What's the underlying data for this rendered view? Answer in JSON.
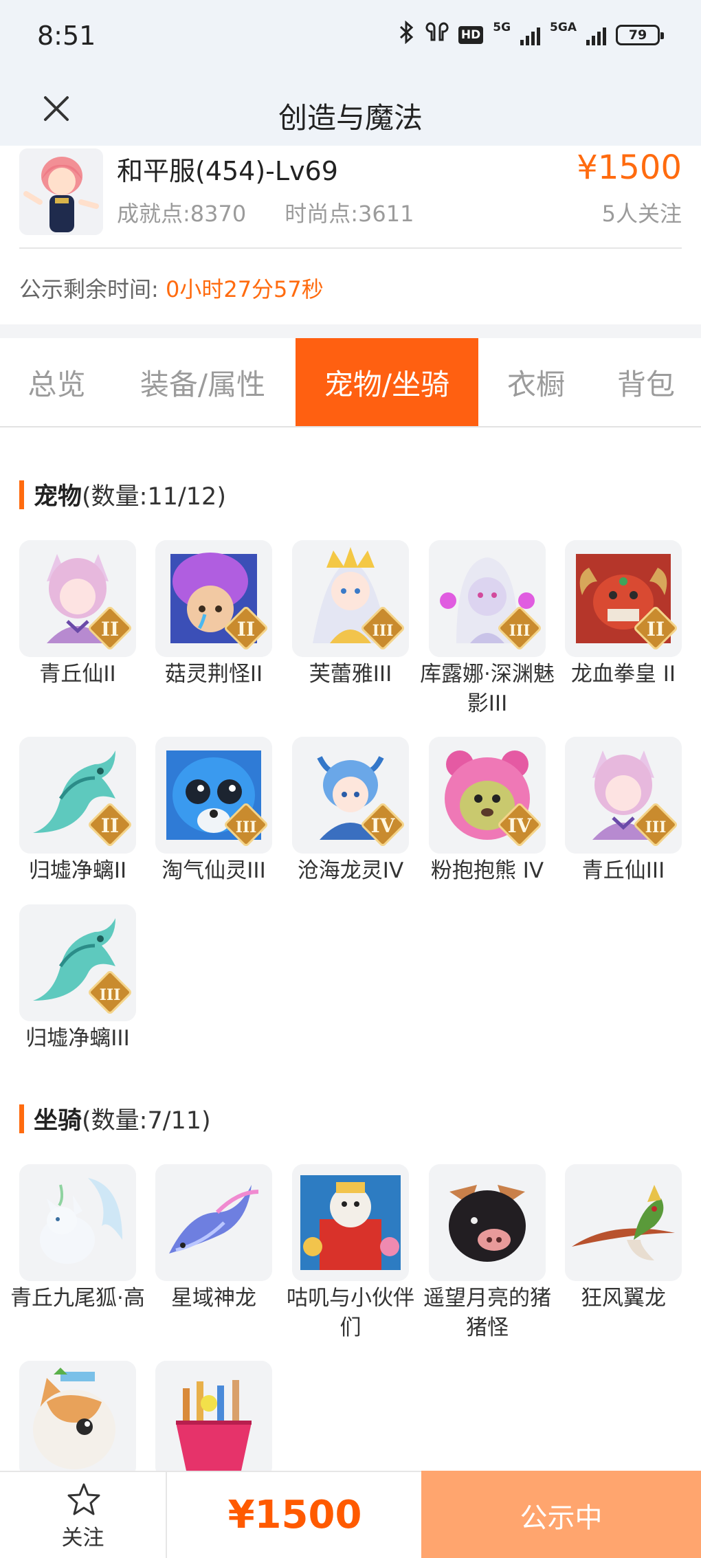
{
  "status_bar": {
    "time": "8:51",
    "battery": "79",
    "hd": "HD",
    "net1": "5G",
    "net2": "5GA"
  },
  "nav": {
    "title": "创造与魔法"
  },
  "listing": {
    "name": "和平服(454)-Lv69",
    "achievement": "成就点:8370",
    "fashion": "时尚点:3611",
    "price": "¥1500",
    "followers": "5人关注",
    "countdown_label": "公示剩余时间:",
    "countdown_value": "0小时27分57秒"
  },
  "tabs": [
    {
      "label": "总览"
    },
    {
      "label": "装备/属性"
    },
    {
      "label": "宠物/坐骑",
      "active": true
    },
    {
      "label": "衣橱"
    },
    {
      "label": "背包"
    }
  ],
  "pets": {
    "title": "宠物",
    "count": "(数量:11/12)",
    "items": [
      {
        "name": "青丘仙II",
        "icon": "fox-fairy-icon",
        "grade": "II"
      },
      {
        "name": "菇灵荆怪II",
        "icon": "mushroom-sprite-icon",
        "grade": "II"
      },
      {
        "name": "芙蕾雅III",
        "icon": "freya-icon",
        "grade": "III"
      },
      {
        "name": "库露娜·深渊魅影III",
        "icon": "kuluna-icon",
        "grade": "III"
      },
      {
        "name": "龙血拳皇 II",
        "icon": "dragon-boxer-icon",
        "grade": "II"
      },
      {
        "name": "归墟净螭II",
        "icon": "jade-dragon-icon",
        "grade": "II"
      },
      {
        "name": "淘气仙灵III",
        "icon": "naughty-sprite-icon",
        "grade": "III"
      },
      {
        "name": "沧海龙灵IV",
        "icon": "sea-dragon-spirit-icon",
        "grade": "IV"
      },
      {
        "name": "粉抱抱熊 IV",
        "icon": "pink-bear-icon",
        "grade": "IV"
      },
      {
        "name": "青丘仙III",
        "icon": "fox-fairy-icon",
        "grade": "III"
      },
      {
        "name": "归墟净螭III",
        "icon": "jade-dragon-icon",
        "grade": "III"
      }
    ]
  },
  "mounts": {
    "title": "坐骑",
    "count": "(数量:7/11)",
    "items": [
      {
        "name": "青丘九尾狐·高",
        "icon": "nine-tail-fox-icon"
      },
      {
        "name": "星域神龙",
        "icon": "star-dragon-icon"
      },
      {
        "name": "咕叽与小伙伴们",
        "icon": "guji-friends-icon"
      },
      {
        "name": "遥望月亮的猪猪怪",
        "icon": "moon-pig-icon"
      },
      {
        "name": "狂风翼龙",
        "icon": "wind-pterosaur-icon"
      },
      {
        "name": "",
        "icon": "cat-mount-icon"
      },
      {
        "name": "",
        "icon": "flower-basket-mount-icon"
      }
    ]
  },
  "bottom": {
    "follow_label": "关注",
    "price": "¥1500",
    "status_label": "公示中"
  },
  "colors": {
    "accent": "#ff6011",
    "price": "#ff6b0f",
    "status_button": "#ffa56e",
    "header_bg": "#eff3f8"
  }
}
